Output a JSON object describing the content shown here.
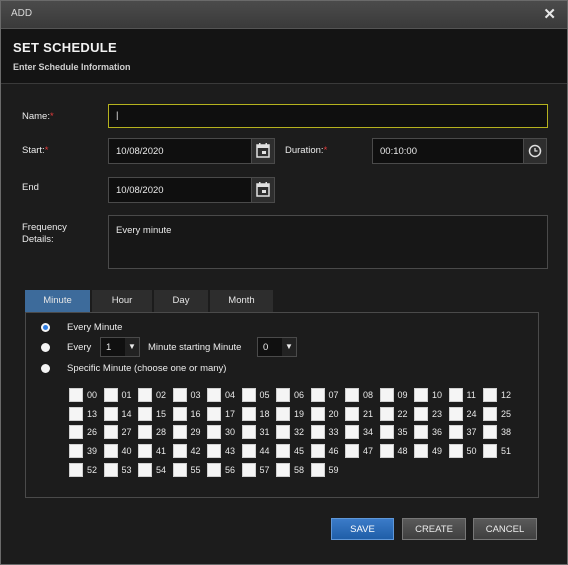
{
  "window": {
    "title": "ADD",
    "close_glyph": "✕"
  },
  "header": {
    "title": "SET SCHEDULE",
    "subtitle": "Enter Schedule Information"
  },
  "form": {
    "name_label": "Name:",
    "required_mark": "*",
    "name_value": "|",
    "start_label": "Start:",
    "start_value": "10/08/2020",
    "duration_label": "Duration:",
    "duration_value": "00:10:00",
    "end_label": "End",
    "end_value": "10/08/2020",
    "frequency_label_1": "Frequency",
    "frequency_label_2": "Details:",
    "frequency_value": "Every minute"
  },
  "tabs": [
    {
      "label": "Minute",
      "active": true
    },
    {
      "label": "Hour",
      "active": false
    },
    {
      "label": "Day",
      "active": false
    },
    {
      "label": "Month",
      "active": false
    }
  ],
  "minute_options": {
    "every_minute": "Every Minute",
    "every": "Every",
    "every_select": "1",
    "starting": "Minute starting Minute",
    "starting_select": "0",
    "specific": "Specific Minute (choose one or many)",
    "selected": "every_minute"
  },
  "minutes": [
    "00",
    "01",
    "02",
    "03",
    "04",
    "05",
    "06",
    "07",
    "08",
    "09",
    "10",
    "11",
    "12",
    "13",
    "14",
    "15",
    "16",
    "17",
    "18",
    "19",
    "20",
    "21",
    "22",
    "23",
    "24",
    "25",
    "26",
    "27",
    "28",
    "29",
    "30",
    "31",
    "32",
    "33",
    "34",
    "35",
    "36",
    "37",
    "38",
    "39",
    "40",
    "41",
    "42",
    "43",
    "44",
    "45",
    "46",
    "47",
    "48",
    "49",
    "50",
    "51",
    "52",
    "53",
    "54",
    "55",
    "56",
    "57",
    "58",
    "59"
  ],
  "buttons": {
    "save": "SAVE",
    "create": "CREATE",
    "cancel": "CANCEL"
  },
  "colors": {
    "accent": "#3d6b9b",
    "primary": "#2a6ab8",
    "required": "#e23b3b",
    "focus": "#b5b21e"
  }
}
